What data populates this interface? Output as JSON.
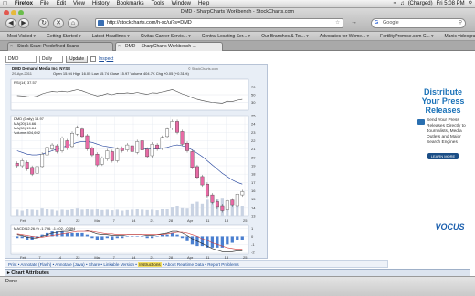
{
  "menubar": {
    "apple": "",
    "items": [
      "Firefox",
      "File",
      "Edit",
      "View",
      "History",
      "Bookmarks",
      "Tools",
      "Window",
      "Help"
    ],
    "battery": "(Charged)",
    "clock": "Fri 5:08 PM"
  },
  "window": {
    "title": "DMD - SharpCharts Workbench - StockCharts.com"
  },
  "toolbar": {
    "url": "http://stockcharts.com/h-sc/ui?s=DMD",
    "search_placeholder": "Google",
    "search_logo": "G"
  },
  "bookmarks": [
    "Most Visited",
    "Getting Started",
    "Latest Headlines",
    "Civitas Career Servic...",
    "Central Locating Ser...",
    "Our Branches & Ter...",
    "Advocates for Wome...",
    "FertilityPromise.com C...",
    "Manic videography"
  ],
  "tabs": [
    {
      "label": "Stock Scan: Predefined Scans -"
    },
    {
      "label": "DMD -- SharpCharts Workbench ..."
    }
  ],
  "page": {
    "symbol": "DMD",
    "period": "Daily",
    "update_label": "Update",
    "inspect_label": "Inspect",
    "chart_header": "DMD Demand Media Inc. NYSE",
    "chart_date": "29-Apr-2011",
    "chart_quote": "Open 15.94  High 16.05  Low 15.74  Close 15.97  Volume 404.7K  Chg +0.05 (+0.31%)",
    "rsi_label": "RSI(14) 37.57",
    "price_legend": [
      "DMD (Daily) 14.97",
      "MA(20) 14.66",
      "MA(50) 15.84",
      "Volume 404,692"
    ],
    "macd_label": "MACD(12,26,9) -1.796, -1.402, -0.394",
    "watermark": "© StockCharts.com",
    "links": [
      "Print",
      "Annotate (Flash)",
      "Annotate (Java)",
      "Share",
      "Linkable Version",
      "Instructions",
      "About Realtime Data",
      "Report Problems"
    ],
    "chart_attributes": "Chart Attributes"
  },
  "ad": {
    "headline": "Distribute Your Press Releases",
    "body": "Send Your Press Releases Directly to Journalists, Media Outlets and Major Search Engines",
    "learn": "LEARN MORE",
    "brand2": "VOCUS"
  },
  "status": {
    "text": "Done"
  },
  "colors": {
    "up_candle": "#ffffff",
    "down_candle": "#e86aa5",
    "ma_line": "#1d3e9a",
    "macd_hist": "#4a7fd0",
    "frame": "#e8eef6"
  },
  "chart_data": {
    "type": "candlestick",
    "x_labels": [
      "Feb",
      "7",
      "14",
      "22",
      "Mar",
      "7",
      "14",
      "21",
      "28",
      "Apr",
      "11",
      "18",
      "25"
    ],
    "price_ticks": [
      13,
      14,
      15,
      16,
      17,
      18,
      19,
      20,
      21,
      22,
      23,
      24,
      25
    ],
    "rsi_ticks": [
      30,
      50,
      70
    ],
    "macd_ticks": [
      1,
      0,
      -1,
      -2
    ],
    "candles": [
      [
        19.3,
        19.0
      ],
      [
        19.0,
        19.6
      ],
      [
        19.4,
        18.6
      ],
      [
        18.8,
        18.0
      ],
      [
        18.1,
        18.9
      ],
      [
        18.9,
        20.4
      ],
      [
        20.3,
        21.2
      ],
      [
        21.0,
        21.5
      ],
      [
        21.4,
        20.7
      ],
      [
        20.8,
        22.3
      ],
      [
        22.0,
        21.1
      ],
      [
        21.3,
        22.9
      ],
      [
        22.8,
        23.6
      ],
      [
        23.4,
        22.5
      ],
      [
        22.6,
        21.0
      ],
      [
        21.1,
        20.3
      ],
      [
        20.4,
        19.1
      ],
      [
        19.2,
        19.9
      ],
      [
        19.8,
        20.8
      ],
      [
        20.7,
        19.6
      ],
      [
        19.6,
        21.0
      ],
      [
        21.1,
        20.8
      ],
      [
        20.9,
        21.5
      ],
      [
        21.4,
        20.7
      ],
      [
        20.6,
        21.9
      ],
      [
        22.0,
        20.9
      ],
      [
        21.0,
        20.1
      ],
      [
        20.2,
        21.6
      ],
      [
        21.5,
        21.0
      ],
      [
        21.1,
        22.4
      ],
      [
        22.5,
        23.4
      ],
      [
        23.5,
        24.3
      ],
      [
        24.3,
        23.0
      ],
      [
        23.1,
        21.6
      ],
      [
        21.7,
        20.8
      ],
      [
        20.7,
        18.8
      ],
      [
        18.9,
        17.6
      ],
      [
        17.7,
        16.7
      ],
      [
        16.8,
        15.4
      ],
      [
        15.5,
        14.6
      ],
      [
        14.7,
        14.1
      ],
      [
        14.2,
        13.6
      ],
      [
        13.7,
        14.8
      ],
      [
        14.9,
        14.3
      ],
      [
        14.2,
        15.6
      ],
      [
        15.5,
        15.9
      ]
    ],
    "ma_line": [
      20.8,
      20.6,
      20.4,
      20.3,
      20.3,
      20.4,
      20.6,
      20.8,
      21.0,
      21.2,
      21.4,
      21.6,
      21.8,
      21.9,
      21.9,
      21.8,
      21.6,
      21.4,
      21.3,
      21.2,
      21.1,
      21.1,
      21.1,
      21.1,
      21.1,
      21.1,
      21.0,
      21.0,
      21.0,
      21.1,
      21.2,
      21.4,
      21.5,
      21.4,
      21.2,
      20.9,
      20.5,
      20.1,
      19.6,
      19.1,
      18.6,
      18.1,
      17.7,
      17.3,
      17.0,
      16.8
    ],
    "rsi": [
      48,
      47,
      45,
      44,
      46,
      52,
      56,
      58,
      57,
      59,
      57,
      60,
      63,
      60,
      55,
      51,
      47,
      49,
      53,
      50,
      54,
      53,
      55,
      53,
      56,
      53,
      51,
      55,
      54,
      57,
      60,
      63,
      58,
      52,
      48,
      42,
      38,
      35,
      32,
      30,
      29,
      28,
      33,
      32,
      36,
      38
    ],
    "macd": [
      0.2,
      0.1,
      -0.1,
      -0.2,
      -0.2,
      0.0,
      0.2,
      0.4,
      0.5,
      0.6,
      0.6,
      0.7,
      0.8,
      0.8,
      0.7,
      0.5,
      0.3,
      0.2,
      0.2,
      0.1,
      0.1,
      0.1,
      0.2,
      0.2,
      0.2,
      0.2,
      0.1,
      0.1,
      0.2,
      0.3,
      0.4,
      0.6,
      0.6,
      0.4,
      0.1,
      -0.3,
      -0.6,
      -0.9,
      -1.2,
      -1.5,
      -1.7,
      -1.9,
      -1.9,
      -1.9,
      -1.8,
      -1.8
    ],
    "signal": [
      0.3,
      0.2,
      0.1,
      0.0,
      -0.1,
      -0.1,
      0.0,
      0.1,
      0.2,
      0.3,
      0.4,
      0.5,
      0.6,
      0.6,
      0.6,
      0.6,
      0.5,
      0.4,
      0.3,
      0.3,
      0.2,
      0.2,
      0.2,
      0.2,
      0.2,
      0.2,
      0.2,
      0.2,
      0.2,
      0.2,
      0.3,
      0.4,
      0.5,
      0.5,
      0.4,
      0.2,
      0.0,
      -0.3,
      -0.5,
      -0.8,
      -1.0,
      -1.2,
      -1.4,
      -1.5,
      -1.6,
      -1.6
    ],
    "volume": [
      0.3,
      0.25,
      0.35,
      0.3,
      0.28,
      0.4,
      0.35,
      0.3,
      0.25,
      0.3,
      0.28,
      0.35,
      0.4,
      0.3,
      0.32,
      0.3,
      0.35,
      0.28,
      0.3,
      0.27,
      0.3,
      0.25,
      0.28,
      0.3,
      0.32,
      0.3,
      0.28,
      0.3,
      0.27,
      0.33,
      0.36,
      0.45,
      0.5,
      0.42,
      0.4,
      0.6,
      0.7,
      0.6,
      0.8,
      0.9,
      0.85,
      0.9,
      0.6,
      0.55,
      0.7,
      0.5
    ]
  }
}
